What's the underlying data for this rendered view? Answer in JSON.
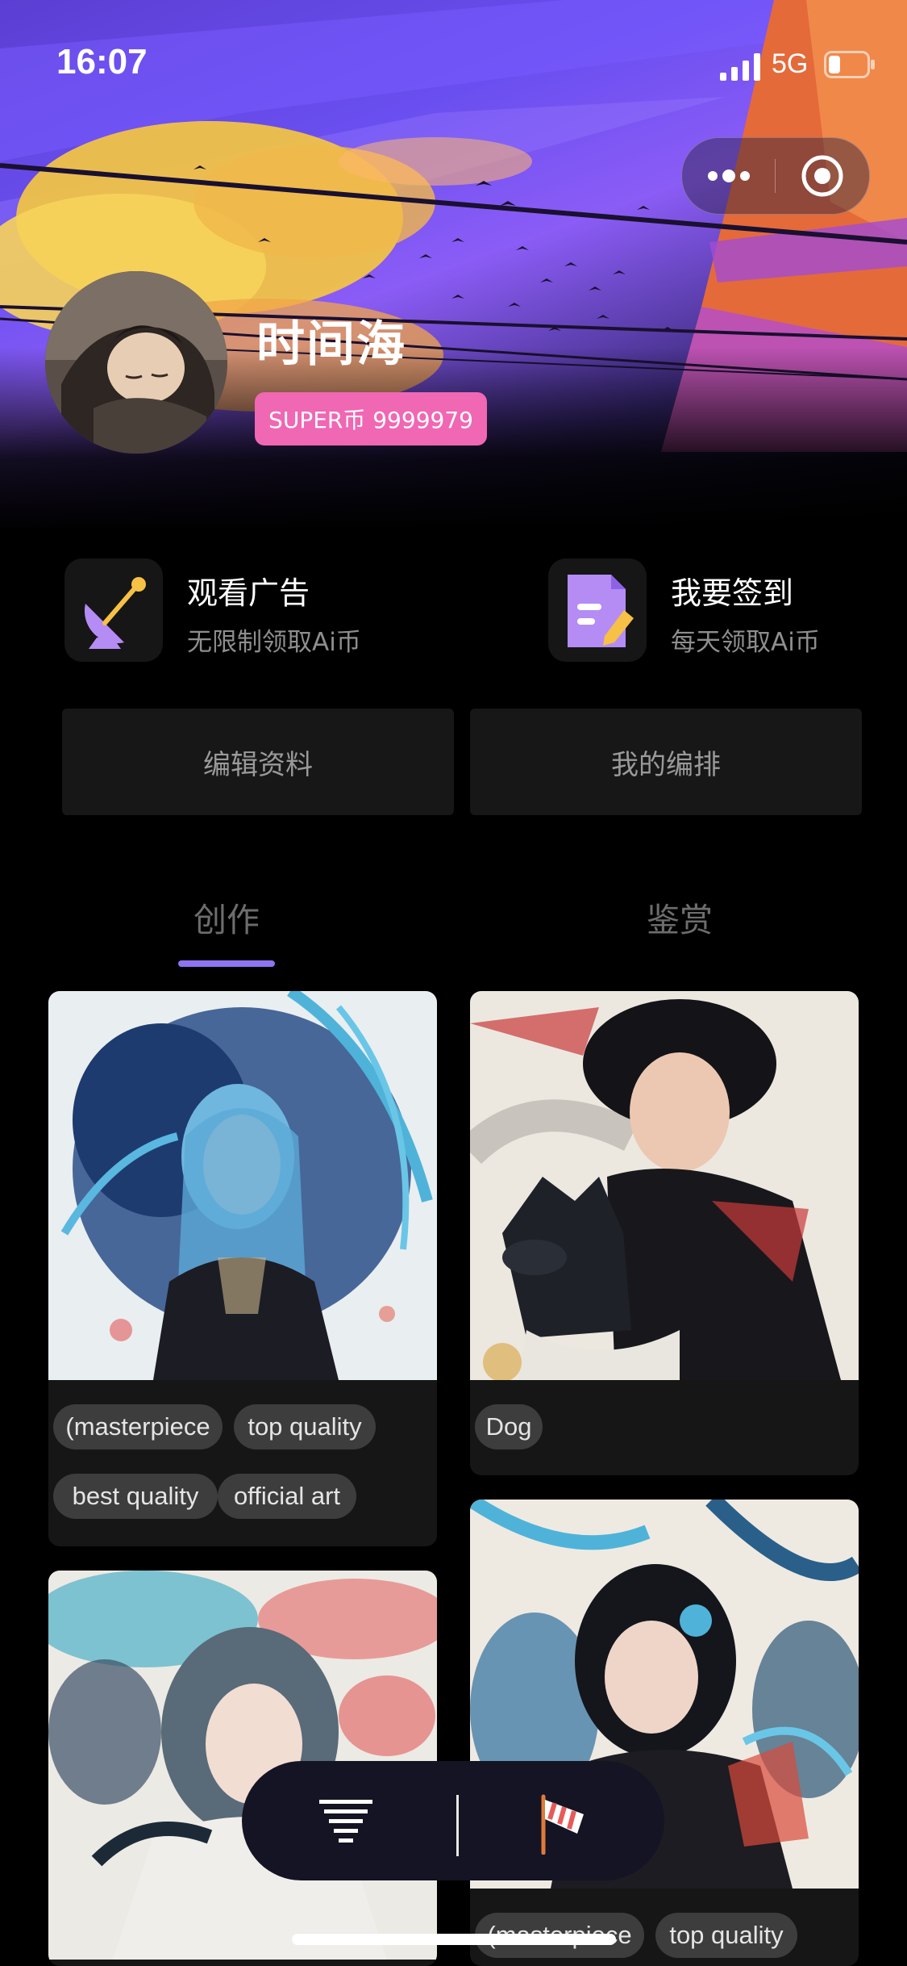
{
  "status_bar": {
    "time": "16:07",
    "network": "5G",
    "icons": [
      "signal-icon",
      "battery-icon"
    ]
  },
  "capsule": {
    "icons": [
      "more-dots-icon",
      "close-target-icon"
    ]
  },
  "profile": {
    "name": "时间海",
    "coin_badge": "SUPER币 9999979",
    "badge_color": "#f067b4"
  },
  "actions": [
    {
      "title": "观看广告",
      "subtitle": "无限制领取Ai币",
      "icon": "satellite-dish-icon"
    },
    {
      "title": "我要签到",
      "subtitle": "每天领取Ai币",
      "icon": "sign-in-note-icon"
    }
  ],
  "buttons": {
    "edit_profile": "编辑资料",
    "my_arrangement": "我的编排"
  },
  "tabs": [
    {
      "label": "创作",
      "active": true
    },
    {
      "label": "鉴赏",
      "active": false
    }
  ],
  "accent_color": "#8f74f2",
  "gallery": {
    "left": [
      {
        "image": "artwork-blue-hair-girl",
        "tags": [
          "(masterpiece",
          "top quality",
          "best quality",
          "official art"
        ]
      },
      {
        "image": "artwork-splash-girl",
        "tags": []
      }
    ],
    "right": [
      {
        "image": "artwork-boy-with-dog",
        "tags": [
          "Dog"
        ]
      },
      {
        "image": "artwork-dark-hair-girl",
        "tags": [
          "(masterpiece",
          "top quality"
        ]
      }
    ]
  },
  "floating_bar": {
    "icons": [
      "filter-icon",
      "flag-icon"
    ]
  }
}
